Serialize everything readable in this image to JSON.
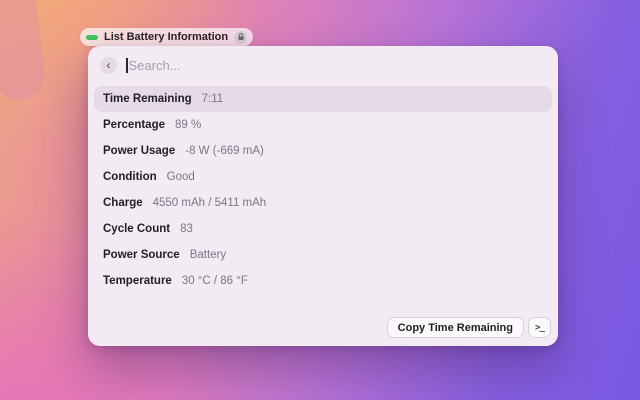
{
  "header_badge": {
    "label": "List Battery Information"
  },
  "search": {
    "placeholder": "Search..."
  },
  "rows": [
    {
      "label": "Time Remaining",
      "value": "7:11",
      "selected": true
    },
    {
      "label": "Percentage",
      "value": "89 %",
      "selected": false
    },
    {
      "label": "Power Usage",
      "value": "-8 W (-669 mA)",
      "selected": false
    },
    {
      "label": "Condition",
      "value": "Good",
      "selected": false
    },
    {
      "label": "Charge",
      "value": "4550 mAh / 5411 mAh",
      "selected": false
    },
    {
      "label": "Cycle Count",
      "value": "83",
      "selected": false
    },
    {
      "label": "Power Source",
      "value": "Battery",
      "selected": false
    },
    {
      "label": "Temperature",
      "value": "30 °C / 86 °F",
      "selected": false
    }
  ],
  "footer": {
    "primary_action_label": "Copy Time Remaining",
    "terminal_glyph": ">_"
  },
  "icons": {
    "back_glyph": "‹"
  },
  "colors": {
    "accent_green": "#3ec45f",
    "panel_bg": "#f3ebf3",
    "selected_row_bg": "#e5dae6",
    "gradient_stops": [
      "#efa585",
      "#dc80bb",
      "#7957e2"
    ]
  }
}
